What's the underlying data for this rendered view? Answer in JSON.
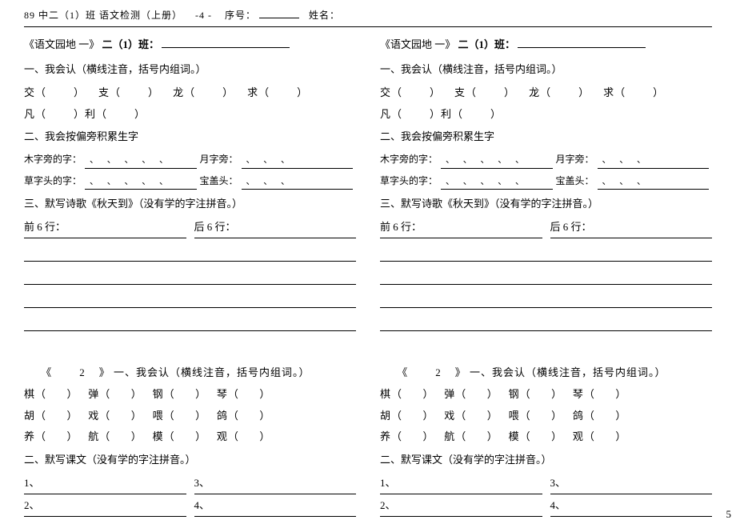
{
  "header": {
    "school": "89 中二（1）班 语文检测（上册）",
    "page": "-4 -",
    "seq_label": "序号：",
    "name_label": "姓名："
  },
  "block1": {
    "title_prefix": "《语文园地 一》",
    "class_label": "二（1）班：",
    "sec1": "一、我会认（横线注音，括号内组词。）",
    "chars_row1": [
      "交（",
      "）",
      "支（",
      "）",
      "龙（",
      "）",
      "求（",
      "）"
    ],
    "chars_row2_left": "凡（",
    "chars_row2_mid": "）利（",
    "chars_row2_end": "）",
    "sec2": "二、我会按偏旁积累生字",
    "wood_label": "木字旁的字：",
    "moon_label": "月字旁：",
    "grass_label": "草字头的字：",
    "roof_label": "宝盖头：",
    "commas": "、   、   、   、   、",
    "commas_short": "、   、   、",
    "sec3": "三、默写诗歌《秋天到》（没有学的字注拼音。）",
    "front6": "前 6 行：",
    "back6": "后 6 行："
  },
  "block2": {
    "title_open": "《",
    "title_num": "2",
    "title_close": "》",
    "sec1": "一、我会认（横线注音，括号内组词。）",
    "r1": [
      "棋（",
      "）",
      "弹（",
      "）",
      "钢（",
      "）",
      "琴（",
      "）"
    ],
    "r2": [
      "胡（",
      "）",
      "戏（",
      "）",
      "喂（",
      "）",
      "鸽（",
      "）"
    ],
    "r3": [
      "养（",
      "）",
      "航（",
      "）",
      "模（",
      "）",
      "观（",
      "）"
    ],
    "sec2": "二、默写课文（没有学的字注拼音。）",
    "n1": "1、",
    "n2": "2、",
    "n3": "3、",
    "n4": "4、"
  },
  "pagenum": "5"
}
